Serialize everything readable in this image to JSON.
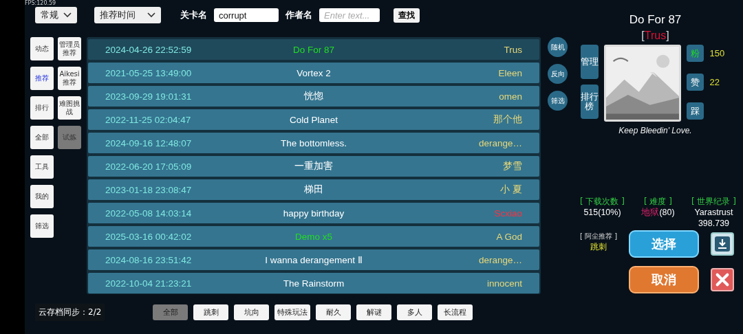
{
  "fps": "FPS:120.59",
  "top_bar": {
    "mode_dropdown": "常规",
    "sort_dropdown": "推荐时间",
    "level_label": "关卡名",
    "level_field": {
      "value": "corrupt"
    },
    "author_label": "作者名",
    "author_field": {
      "placeholder": "Enter text..."
    },
    "search_button": "查找"
  },
  "nav_primary": [
    {
      "label": "动态",
      "selected": false
    },
    {
      "label": "推荐",
      "selected": true
    },
    {
      "label": "排行",
      "selected": false
    },
    {
      "label": "全部",
      "selected": false
    },
    {
      "label": "工具",
      "selected": false
    },
    {
      "label": "我的",
      "selected": false
    },
    {
      "label": "筛选",
      "selected": false
    }
  ],
  "nav_secondary": [
    {
      "label": "管理员推荐",
      "selected": false
    },
    {
      "label": "Aikesi推荐",
      "selected": false
    },
    {
      "label": "难图挑战",
      "selected": false
    },
    {
      "label": "试炼",
      "selected": true
    }
  ],
  "rows": [
    {
      "date": "2024-04-26 22:52:59",
      "title": {
        "text": "Do For 87",
        "color": "#22dd22"
      },
      "author": {
        "text": "Trus",
        "color": "#e8d878"
      },
      "selected": true
    },
    {
      "date": "2021-05-25 13:49:00",
      "title": {
        "text": "Vortex 2",
        "color": "#ffffff"
      },
      "author": {
        "text": "Eleen",
        "color": "#e8d878"
      },
      "selected": false
    },
    {
      "date": "2023-09-29 19:01:31",
      "title": {
        "text": "恍惚",
        "color": "#ffffff"
      },
      "author": {
        "text": "omen",
        "color": "#e8d878"
      },
      "selected": false
    },
    {
      "date": "2022-11-25 02:04:47",
      "title": {
        "text": "Cold Planet",
        "color": "#ffffff"
      },
      "author": {
        "text": "那个他",
        "color": "#e8d878"
      },
      "selected": false
    },
    {
      "date": "2024-09-16 12:48:07",
      "title": {
        "text": "The bottomless.",
        "color": "#ffffff"
      },
      "author": {
        "text": "derange…",
        "color": "#e8d878"
      },
      "selected": false
    },
    {
      "date": "2022-06-20 17:05:09",
      "title": {
        "text": "一重加害",
        "color": "#ffffff"
      },
      "author": {
        "text": "梦雪",
        "color": "#e8d878"
      },
      "selected": false
    },
    {
      "date": "2023-01-18 23:08:47",
      "title": {
        "text": "梯田",
        "color": "#ffffff"
      },
      "author": {
        "text": "小 夏",
        "color": "#e8d878"
      },
      "selected": false
    },
    {
      "date": "2022-05-08 14:03:14",
      "title": {
        "text": "happy birthday",
        "color": "#ffffff"
      },
      "author": {
        "text": "Scxiao",
        "color": "#ff3040"
      },
      "selected": false
    },
    {
      "date": "2025-03-16 00:42:02",
      "title": {
        "text": "Demo x5",
        "color": "#22dd22"
      },
      "author": {
        "text": "A God",
        "color": "#e8d878"
      },
      "selected": false
    },
    {
      "date": "2024-08-16 23:51:42",
      "title": {
        "text": "I wanna derangement Ⅱ",
        "color": "#ffffff"
      },
      "author": {
        "text": "derange…",
        "color": "#e8d878"
      },
      "selected": false
    },
    {
      "date": "2022-10-04 21:23:21",
      "title": {
        "text": "The Rainstorm",
        "color": "#ffffff"
      },
      "author": {
        "text": "innocent",
        "color": "#e8d878"
      },
      "selected": false
    }
  ],
  "round_buttons": [
    "随机",
    "反向",
    "筛选"
  ],
  "detail": {
    "title": "Do For 87",
    "author": {
      "open": "[",
      "name": "Trus",
      "close": "]"
    },
    "side_buttons": [
      "管理",
      "排行榜"
    ],
    "reactions": [
      {
        "label": "粉",
        "on": true,
        "count": "150"
      },
      {
        "label": "赞",
        "on": false,
        "count": "22"
      },
      {
        "label": "踩",
        "on": false
      }
    ],
    "motto": "Keep Bleedin' Love.",
    "stats": [
      {
        "label": "[ 下载次数 ]",
        "value": "515(10%)"
      },
      {
        "label": "[ 难度 ]",
        "value_accent": "地狱",
        "value": "(80)"
      },
      {
        "label": "[ 世界纪录 ]",
        "value": "Yarastrust",
        "value_2": "398.739"
      }
    ],
    "recommend_label": "[ 阿尘推荐 ]",
    "recommend_value": "跳刺",
    "select_button": "选择",
    "cancel_button": "取消"
  },
  "cloud_sync": "云存档同步：2/2",
  "tags": [
    {
      "label": "全部",
      "selected": true
    },
    {
      "label": "跳刺",
      "selected": false
    },
    {
      "label": "坑向",
      "selected": false
    },
    {
      "label": "特殊玩法",
      "selected": false
    },
    {
      "label": "耐久",
      "selected": false
    },
    {
      "label": "解谜",
      "selected": false
    },
    {
      "label": "多人",
      "selected": false
    },
    {
      "label": "长流程",
      "selected": false
    }
  ]
}
